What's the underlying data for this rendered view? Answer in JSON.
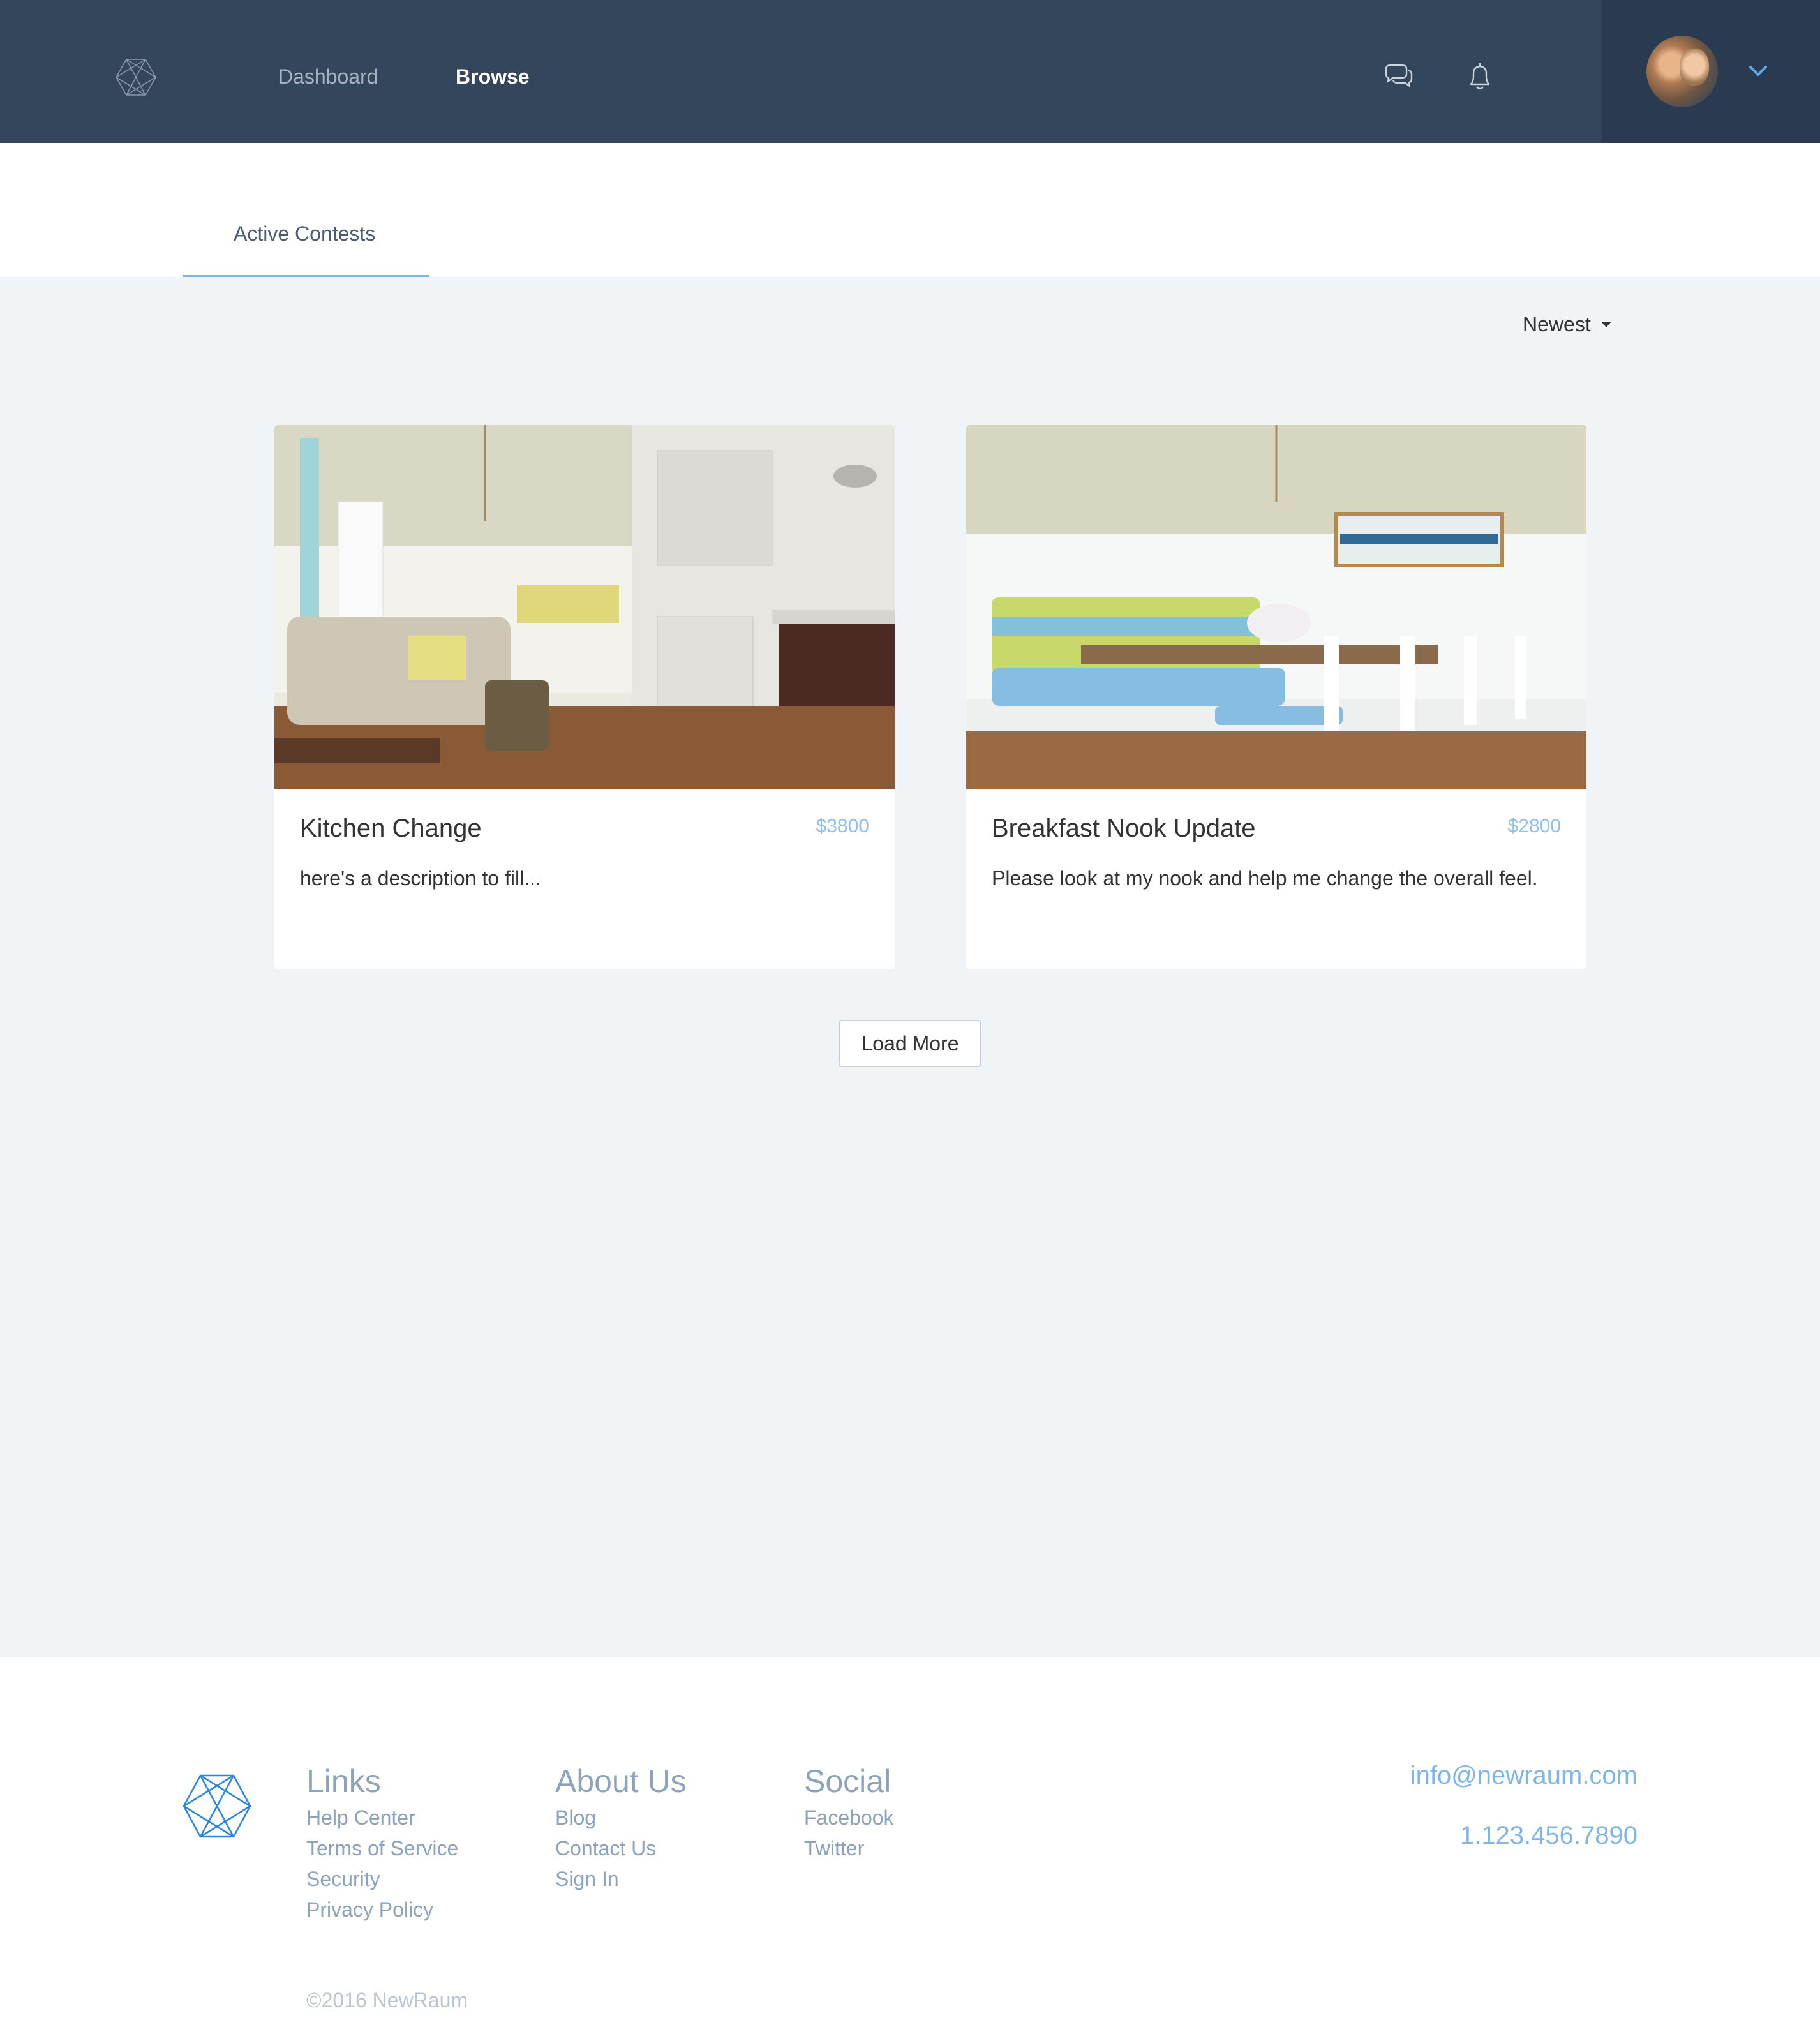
{
  "header": {
    "nav": [
      {
        "label": "Dashboard",
        "active": false
      },
      {
        "label": "Browse",
        "active": true
      }
    ],
    "icons": [
      "chat-icon",
      "bell-icon",
      "chevron-down-icon"
    ],
    "colors": {
      "bar": "#34465c",
      "user_zone": "#2a3b51",
      "accent": "#7fb6e6"
    }
  },
  "tabs": [
    {
      "label": "Active Contests",
      "active": true
    }
  ],
  "sort": {
    "selected": "Newest"
  },
  "contests": [
    {
      "title": "Kitchen Change",
      "price": "$3800",
      "description": "here's a description to fill..."
    },
    {
      "title": "Breakfast Nook Update",
      "price": "$2800",
      "description": "Please look at my nook and help me change the overall feel."
    }
  ],
  "load_more_label": "Load More",
  "footer": {
    "columns": [
      {
        "heading": "Links",
        "links": [
          "Help Center",
          "Terms of Service",
          "Security",
          "Privacy Policy"
        ]
      },
      {
        "heading": "About Us",
        "links": [
          "Blog",
          "Contact Us",
          "Sign In"
        ]
      },
      {
        "heading": "Social",
        "links": [
          "Facebook",
          "Twitter"
        ]
      }
    ],
    "email": "info@newraum.com",
    "phone": "1.123.456.7890",
    "copyright": "©2016 NewRaum"
  }
}
